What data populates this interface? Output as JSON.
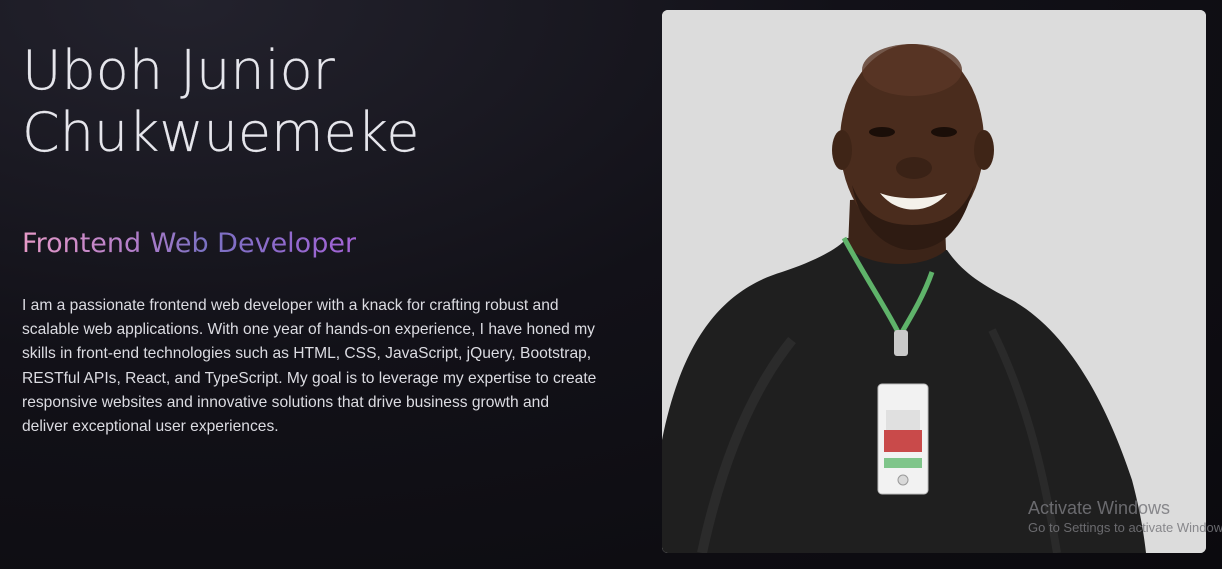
{
  "hero": {
    "name_line1": "Uboh Junior",
    "name_line2": "Chukwuemeke",
    "role": "Frontend Web Developer",
    "bio": "I am a passionate frontend web developer with a knack for crafting robust and scalable web applications. With one year of hands-on experience, I have honed my skills in front-end technologies such as HTML, CSS, JavaScript, jQuery, Bootstrap, RESTful APIs, React, and TypeScript. My goal is to leverage my expertise to create responsive websites and innovative solutions that drive business growth and deliver exceptional user experiences."
  },
  "photo": {
    "subject": "portrait-of-developer",
    "background_color": "#dcdcdc"
  },
  "role_gradient": [
    "#e79ac8",
    "#b07cc9",
    "#7a71c2",
    "#a463d6"
  ],
  "watermark": {
    "title": "Activate Windows",
    "subtitle": "Go to Settings to activate Windows."
  }
}
